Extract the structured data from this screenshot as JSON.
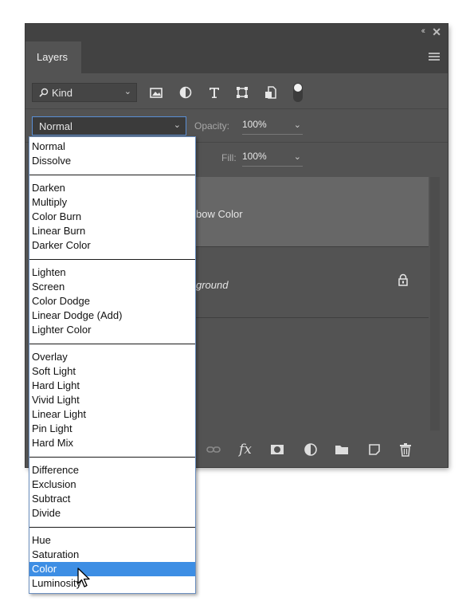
{
  "panel": {
    "tab_label": "Layers",
    "collapse_glyph": "‹‹",
    "close_glyph": "✕"
  },
  "filter": {
    "kind_label": "Kind"
  },
  "blend": {
    "current_mode": "Normal",
    "opacity_label": "Opacity:",
    "opacity_value": "100%",
    "fill_label": "Fill:",
    "fill_value": "100%"
  },
  "layers": [
    {
      "name_visible": "bow Color",
      "selected": true,
      "locked": false
    },
    {
      "name_visible": "ground",
      "selected": false,
      "locked": true
    }
  ],
  "blend_modes": {
    "groups": [
      [
        "Normal",
        "Dissolve"
      ],
      [
        "Darken",
        "Multiply",
        "Color Burn",
        "Linear Burn",
        "Darker Color"
      ],
      [
        "Lighten",
        "Screen",
        "Color Dodge",
        "Linear Dodge (Add)",
        "Lighter Color"
      ],
      [
        "Overlay",
        "Soft Light",
        "Hard Light",
        "Vivid Light",
        "Linear Light",
        "Pin Light",
        "Hard Mix"
      ],
      [
        "Difference",
        "Exclusion",
        "Subtract",
        "Divide"
      ],
      [
        "Hue",
        "Saturation",
        "Color",
        "Luminosity"
      ]
    ],
    "highlighted": "Color"
  },
  "colors": {
    "panel_bg": "#535353",
    "selected_row": "#676767",
    "highlight": "#3d8ee4"
  }
}
